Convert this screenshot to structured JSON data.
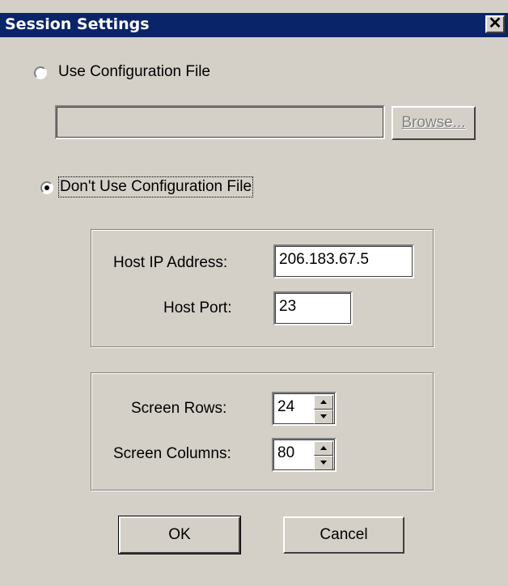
{
  "window": {
    "title": "Session Settings",
    "close_label": "✕"
  },
  "config": {
    "use_file_label": "Use Configuration File",
    "file_path_value": "",
    "browse_label": "Browse...",
    "dont_use_label": "Don't Use Configuration File",
    "selected": "dont_use"
  },
  "host": {
    "ip_label": "Host IP Address:",
    "ip_value": "206.183.67.5",
    "port_label": "Host Port:",
    "port_value": "23"
  },
  "screen": {
    "rows_label": "Screen Rows:",
    "rows_value": "24",
    "cols_label": "Screen Columns:",
    "cols_value": "80"
  },
  "buttons": {
    "ok_label": "OK",
    "cancel_label": "Cancel"
  }
}
